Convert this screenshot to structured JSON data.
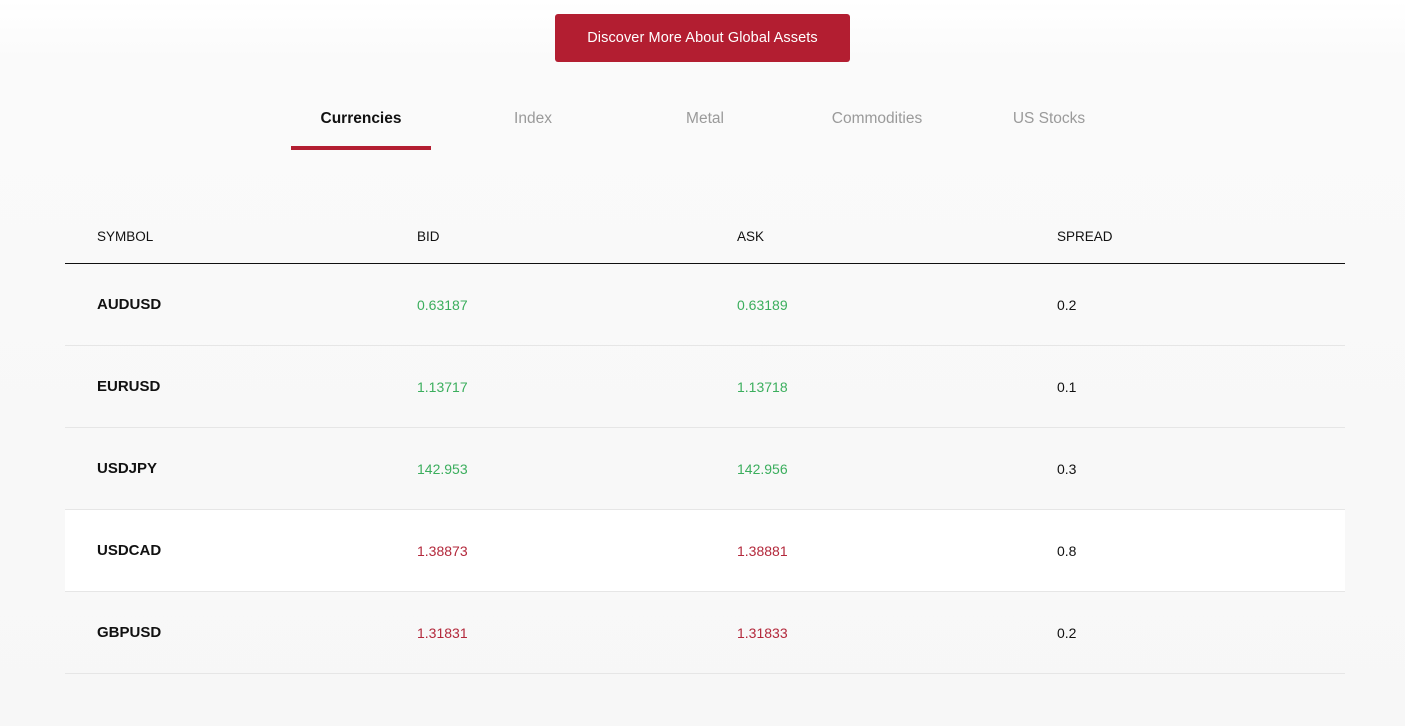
{
  "cta": {
    "label": "Discover More About Global Assets",
    "color": "#b31e31"
  },
  "tabs": [
    {
      "label": "Currencies",
      "active": true
    },
    {
      "label": "Index",
      "active": false
    },
    {
      "label": "Metal",
      "active": false
    },
    {
      "label": "Commodities",
      "active": false
    },
    {
      "label": "US Stocks",
      "active": false
    }
  ],
  "table": {
    "headers": {
      "symbol": "SYMBOL",
      "bid": "BID",
      "ask": "ASK",
      "spread": "SPREAD"
    },
    "colors": {
      "up": "#3bae5d",
      "down": "#b3283b"
    },
    "rows": [
      {
        "symbol": "AUDUSD",
        "bid": "0.63187",
        "ask": "0.63189",
        "spread": "0.2",
        "direction": "up"
      },
      {
        "symbol": "EURUSD",
        "bid": "1.13717",
        "ask": "1.13718",
        "spread": "0.1",
        "direction": "up"
      },
      {
        "symbol": "USDJPY",
        "bid": "142.953",
        "ask": "142.956",
        "spread": "0.3",
        "direction": "up"
      },
      {
        "symbol": "USDCAD",
        "bid": "1.38873",
        "ask": "1.38881",
        "spread": "0.8",
        "direction": "down"
      },
      {
        "symbol": "GBPUSD",
        "bid": "1.31831",
        "ask": "1.31833",
        "spread": "0.2",
        "direction": "down"
      }
    ]
  }
}
